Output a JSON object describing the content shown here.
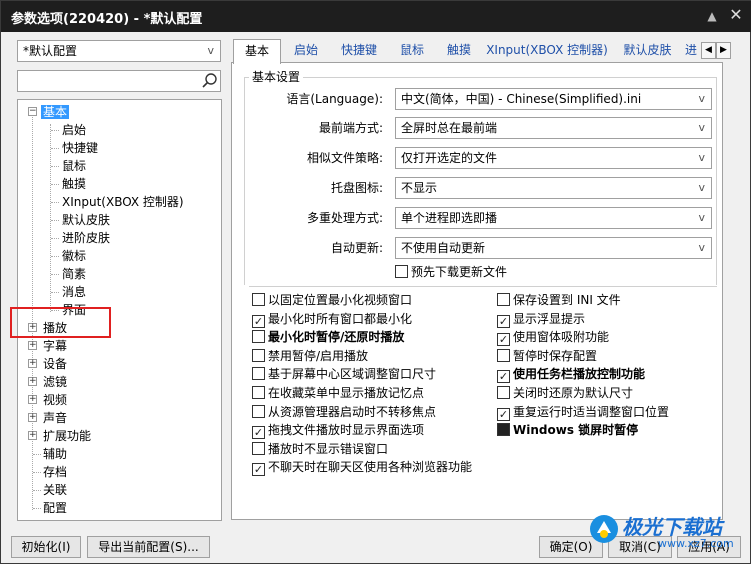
{
  "window": {
    "title": "参数选项(220420) - *默认配置"
  },
  "titlebar_icons": {
    "pin": "pin-icon",
    "close": "close-icon"
  },
  "profile_select": {
    "value": "*默认配置"
  },
  "search": {
    "value": "",
    "icon": "search-icon"
  },
  "tree": {
    "root": "基本",
    "children": [
      "启始",
      "快捷键",
      "鼠标",
      "触摸",
      "XInput(XBOX 控制器)",
      "默认皮肤",
      "进阶皮肤",
      "徽标",
      "简素",
      "消息",
      "界面"
    ],
    "top": [
      "播放",
      "字幕",
      "设备",
      "滤镜",
      "视频",
      "声音",
      "扩展功能",
      "辅助",
      "存档",
      "关联",
      "配置"
    ]
  },
  "tabs": [
    "基本",
    "启始",
    "快捷键",
    "鼠标",
    "触摸",
    "XInput(XBOX 控制器)",
    "默认皮肤",
    "进"
  ],
  "basic": {
    "group_title": "基本设置",
    "fields": [
      {
        "label": "语言(Language):",
        "value": "中文(简体，中国) - Chinese(Simplified).ini"
      },
      {
        "label": "最前端方式:",
        "value": "全屏时总在最前端"
      },
      {
        "label": "相似文件策略:",
        "value": "仅打开选定的文件"
      },
      {
        "label": "托盘图标:",
        "value": "不显示"
      },
      {
        "label": "多重处理方式:",
        "value": "单个进程即选即播"
      },
      {
        "label": "自动更新:",
        "value": "不使用自动更新"
      }
    ],
    "predownload": {
      "label": "预先下载更新文件",
      "checked": false
    }
  },
  "options_left": [
    {
      "label": "以固定位置最小化视频窗口",
      "checked": false,
      "bold": false
    },
    {
      "label": "最小化时所有窗口都最小化",
      "checked": true,
      "bold": false
    },
    {
      "label": "最小化时暂停/还原时播放",
      "checked": false,
      "bold": true
    },
    {
      "label": "禁用暂停/启用播放",
      "checked": false,
      "bold": false
    },
    {
      "label": "基于屏幕中心区域调整窗口尺寸",
      "checked": false,
      "bold": false
    },
    {
      "label": "在收藏菜单中显示播放记忆点",
      "checked": false,
      "bold": false
    },
    {
      "label": "从资源管理器启动时不转移焦点",
      "checked": false,
      "bold": false
    },
    {
      "label": "拖拽文件播放时显示界面选项",
      "checked": true,
      "bold": false
    },
    {
      "label": "播放时不显示错误窗口",
      "checked": false,
      "bold": false
    },
    {
      "label": "不聊天时在聊天区使用各种浏览器功能",
      "checked": true,
      "bold": false
    }
  ],
  "options_right": [
    {
      "label": "保存设置到 INI 文件",
      "checked": false,
      "bold": false,
      "filled": false
    },
    {
      "label": "显示浮显提示",
      "checked": true,
      "bold": false,
      "filled": false
    },
    {
      "label": "使用窗体吸附功能",
      "checked": true,
      "bold": false,
      "filled": false
    },
    {
      "label": "暂停时保存配置",
      "checked": false,
      "bold": false,
      "filled": false
    },
    {
      "label": "使用任务栏播放控制功能",
      "checked": true,
      "bold": true,
      "filled": false
    },
    {
      "label": "关闭时还原为默认尺寸",
      "checked": false,
      "bold": false,
      "filled": false
    },
    {
      "label": "重复运行时适当调整窗口位置",
      "checked": true,
      "bold": false,
      "filled": false
    },
    {
      "label": "Windows 锁屏时暂停",
      "checked": false,
      "bold": true,
      "filled": true
    }
  ],
  "buttons": {
    "init": "初始化(I)",
    "export": "导出当前配置(S)...",
    "ok": "确定(O)",
    "cancel": "取消(C)",
    "apply": "应用(A)"
  },
  "watermark": {
    "title": "极光下载站",
    "url": "www.xz7.com"
  }
}
